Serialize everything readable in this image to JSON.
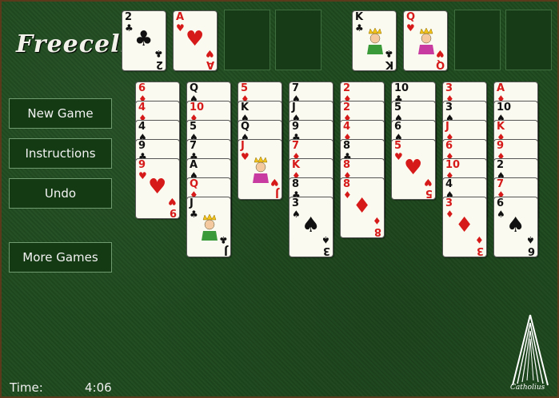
{
  "app": {
    "title": "Freecell",
    "brand": "Catholius"
  },
  "menu": {
    "new_game": "New Game",
    "instructions": "Instructions",
    "undo": "Undo",
    "more_games": "More Games"
  },
  "status": {
    "time_label": "Time:",
    "time_value": "4:06"
  },
  "colors": {
    "felt": "#1f4a1f",
    "card": "#fbfaf0",
    "red": "#d61a1a",
    "black": "#111111",
    "button_border": "#6f9a6f"
  },
  "free_cells": [
    {
      "rank": "2",
      "suit": "♣"
    },
    {
      "rank": "A",
      "suit": "♥"
    },
    null,
    null
  ],
  "foundations": [
    {
      "rank": "K",
      "suit": "♣"
    },
    {
      "rank": "Q",
      "suit": "♥"
    },
    null,
    null
  ],
  "tableau": [
    [
      {
        "rank": "6",
        "suit": "♦"
      },
      {
        "rank": "4",
        "suit": "♦"
      },
      {
        "rank": "4",
        "suit": "♠"
      },
      {
        "rank": "9",
        "suit": "♣"
      },
      {
        "rank": "9",
        "suit": "♥"
      }
    ],
    [
      {
        "rank": "Q",
        "suit": "♠"
      },
      {
        "rank": "10",
        "suit": "♦"
      },
      {
        "rank": "5",
        "suit": "♠"
      },
      {
        "rank": "7",
        "suit": "♣"
      },
      {
        "rank": "A",
        "suit": "♠"
      },
      {
        "rank": "Q",
        "suit": "♦"
      },
      {
        "rank": "J",
        "suit": "♣"
      }
    ],
    [
      {
        "rank": "5",
        "suit": "♦"
      },
      {
        "rank": "K",
        "suit": "♠"
      },
      {
        "rank": "Q",
        "suit": "♠"
      },
      {
        "rank": "J",
        "suit": "♥"
      }
    ],
    [
      {
        "rank": "7",
        "suit": "♠"
      },
      {
        "rank": "J",
        "suit": "♠"
      },
      {
        "rank": "9",
        "suit": "♣"
      },
      {
        "rank": "7",
        "suit": "♦"
      },
      {
        "rank": "K",
        "suit": "♦"
      },
      {
        "rank": "8",
        "suit": "♣"
      },
      {
        "rank": "3",
        "suit": "♠"
      }
    ],
    [
      {
        "rank": "2",
        "suit": "♦"
      },
      {
        "rank": "2",
        "suit": "♦"
      },
      {
        "rank": "4",
        "suit": "♦"
      },
      {
        "rank": "8",
        "suit": "♣"
      },
      {
        "rank": "8",
        "suit": "♦"
      },
      {
        "rank": "8",
        "suit": "♦"
      }
    ],
    [
      {
        "rank": "10",
        "suit": "♣"
      },
      {
        "rank": "5",
        "suit": "♠"
      },
      {
        "rank": "6",
        "suit": "♠"
      },
      {
        "rank": "5",
        "suit": "♥"
      }
    ],
    [
      {
        "rank": "3",
        "suit": "♦"
      },
      {
        "rank": "3",
        "suit": "♠"
      },
      {
        "rank": "J",
        "suit": "♦"
      },
      {
        "rank": "6",
        "suit": "♦"
      },
      {
        "rank": "10",
        "suit": "♦"
      },
      {
        "rank": "4",
        "suit": "♠"
      },
      {
        "rank": "3",
        "suit": "♦"
      }
    ],
    [
      {
        "rank": "A",
        "suit": "♦"
      },
      {
        "rank": "10",
        "suit": "♠"
      },
      {
        "rank": "K",
        "suit": "♦"
      },
      {
        "rank": "9",
        "suit": "♦"
      },
      {
        "rank": "2",
        "suit": "♠"
      },
      {
        "rank": "7",
        "suit": "♦"
      },
      {
        "rank": "6",
        "suit": "♠"
      }
    ]
  ]
}
